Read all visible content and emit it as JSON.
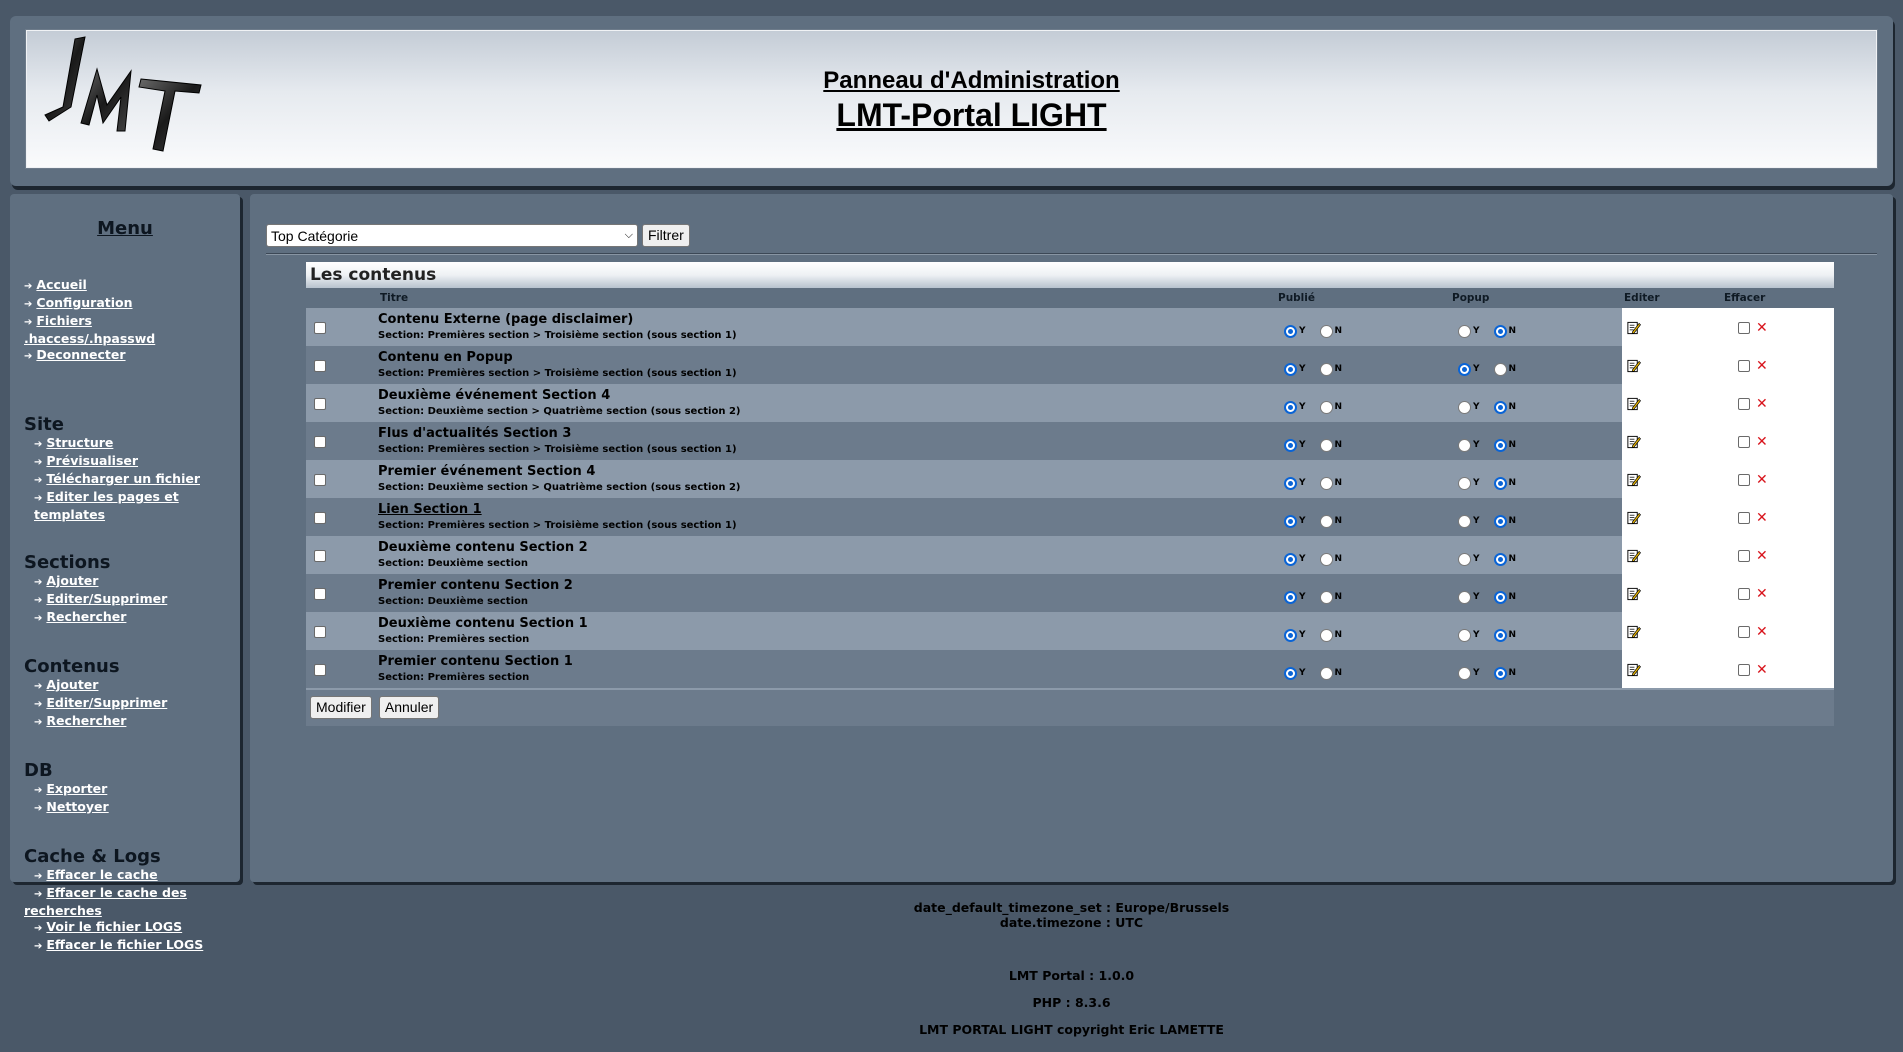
{
  "header": {
    "logo_text": "LMT",
    "title_line1": "Panneau d'Administration",
    "title_line2": "LMT-Portal LIGHT"
  },
  "sidebar": {
    "menu_title": "Menu",
    "top_links": [
      "Accueil",
      "Configuration",
      "Fichiers .haccess/.hpasswd",
      "Deconnecter"
    ],
    "sections": [
      {
        "title": "Site",
        "items": [
          "Structure",
          "Prévisualiser",
          "Télécharger un fichier",
          "Editer les pages et templates"
        ]
      },
      {
        "title": "Sections",
        "items": [
          "Ajouter",
          "Editer/Supprimer",
          "Rechercher"
        ]
      },
      {
        "title": "Contenus",
        "items": [
          "Ajouter",
          "Editer/Supprimer",
          "Rechercher"
        ]
      },
      {
        "title": "DB",
        "items": [
          "Exporter",
          "Nettoyer"
        ]
      },
      {
        "title": "Cache & Logs",
        "items": [
          "Effacer le cache",
          "Effacer le cache des recherches",
          "Voir le fichier LOGS",
          "Effacer le fichier LOGS"
        ]
      }
    ]
  },
  "filter": {
    "selected": "Top Catégorie",
    "button": "Filtrer"
  },
  "table": {
    "title": "Les contenus",
    "columns": {
      "titre": "Titre",
      "publie": "Publié",
      "popup": "Popup",
      "editer": "Editer",
      "effacer": "Effacer"
    },
    "radio_yes": "Y",
    "radio_no": "N",
    "rows": [
      {
        "title": "Contenu Externe (page disclaimer)",
        "section": "Section: Premières section > Troisième section (sous section 1)",
        "link": false,
        "published": "Y",
        "popup": "N"
      },
      {
        "title": "Contenu en Popup",
        "section": "Section: Premières section > Troisième section (sous section 1)",
        "link": false,
        "published": "Y",
        "popup": "Y"
      },
      {
        "title": "Deuxième événement Section 4",
        "section": "Section: Deuxième section > Quatrième section (sous section 2)",
        "link": false,
        "published": "Y",
        "popup": "N"
      },
      {
        "title": "Flus d'actualités Section 3",
        "section": "Section: Premières section > Troisième section (sous section 1)",
        "link": false,
        "published": "Y",
        "popup": "N"
      },
      {
        "title": "Premier événement Section 4",
        "section": "Section: Deuxième section > Quatrième section (sous section 2)",
        "link": false,
        "published": "Y",
        "popup": "N"
      },
      {
        "title": "Lien Section 1",
        "section": "Section: Premières section > Troisième section (sous section 1)",
        "link": true,
        "published": "Y",
        "popup": "N"
      },
      {
        "title": "Deuxième contenu Section 2",
        "section": "Section: Deuxième section",
        "link": false,
        "published": "Y",
        "popup": "N"
      },
      {
        "title": "Premier contenu Section 2",
        "section": "Section: Deuxième section",
        "link": false,
        "published": "Y",
        "popup": "N"
      },
      {
        "title": "Deuxième contenu Section 1",
        "section": "Section: Premières section",
        "link": false,
        "published": "Y",
        "popup": "N"
      },
      {
        "title": "Premier contenu Section 1",
        "section": "Section: Premières section",
        "link": false,
        "published": "Y",
        "popup": "N"
      }
    ],
    "btn_modify": "Modifier",
    "btn_cancel": "Annuler"
  },
  "footer": {
    "tz1": "date_default_timezone_set : Europe/Brussels",
    "tz2": "date.timezone : UTC",
    "version": "LMT Portal : 1.0.0",
    "php": "PHP : 8.3.6",
    "copyright": "LMT PORTAL LIGHT copyright Eric LAMETTE"
  },
  "icons": {
    "nav_arrow": "arrow-right-icon",
    "edit": "edit-note-icon",
    "delete": "red-x-icon"
  },
  "colors": {
    "background": "#4a5868",
    "panel": "#5f6f80",
    "row_light": "#8c9aaa",
    "row_dark": "#6c7b8c",
    "radio_selected": "#0a64d6",
    "delete_red": "#d8141c"
  }
}
